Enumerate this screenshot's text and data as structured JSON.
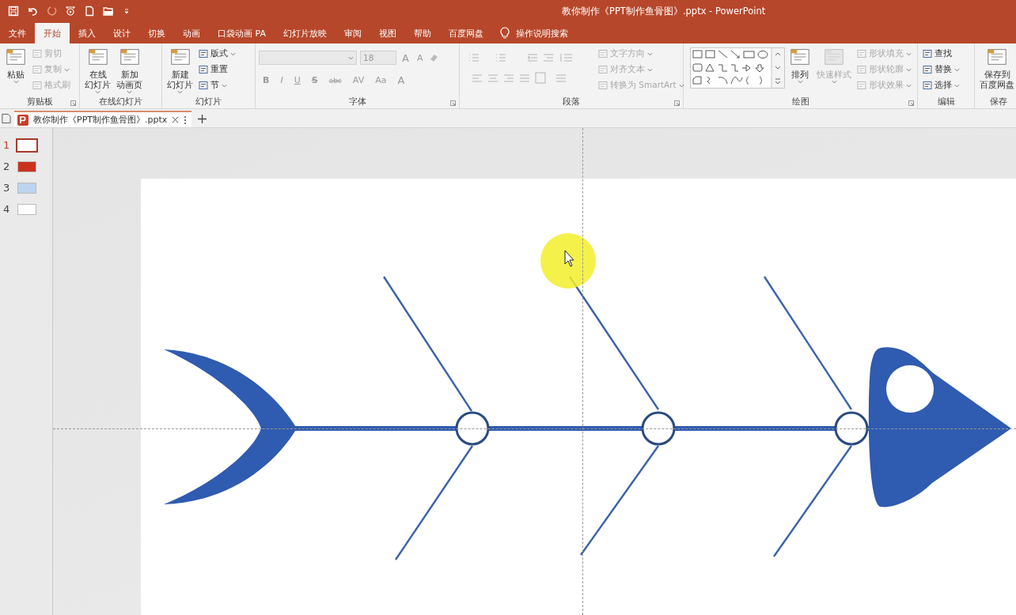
{
  "window": {
    "title": "教你制作《PPT制作鱼骨图》.pptx  -  PowerPoint"
  },
  "menu_tabs": [
    {
      "label": "文件",
      "selected": false
    },
    {
      "label": "开始",
      "selected": true
    },
    {
      "label": "插入",
      "selected": false
    },
    {
      "label": "设计",
      "selected": false
    },
    {
      "label": "切换",
      "selected": false
    },
    {
      "label": "动画",
      "selected": false
    },
    {
      "label": "口袋动画 PA",
      "selected": false
    },
    {
      "label": "幻灯片放映",
      "selected": false
    },
    {
      "label": "审阅",
      "selected": false
    },
    {
      "label": "视图",
      "selected": false
    },
    {
      "label": "帮助",
      "selected": false
    },
    {
      "label": "百度网盘",
      "selected": false
    }
  ],
  "tell_me": {
    "placeholder": "操作说明搜索"
  },
  "ribbon_groups": [
    {
      "label": "剪贴板",
      "launcher": true,
      "columns": [
        {
          "kind": "large",
          "lines": [
            "粘贴"
          ],
          "dropdown": true,
          "disabled": false
        },
        {
          "kind": "stack",
          "items": [
            {
              "label": "剪切",
              "dropdown": false,
              "disabled": true
            },
            {
              "label": "复制",
              "dropdown": true,
              "disabled": true
            },
            {
              "label": "格式刷",
              "dropdown": false,
              "disabled": true
            }
          ]
        }
      ]
    },
    {
      "label": "在线幻灯片",
      "launcher": false,
      "columns": [
        {
          "kind": "large",
          "lines": [
            "在线",
            "幻灯片"
          ],
          "dropdown": true,
          "disabled": false
        },
        {
          "kind": "large",
          "lines": [
            "新加",
            "动画页"
          ],
          "dropdown": true,
          "disabled": false
        }
      ]
    },
    {
      "label": "幻灯片",
      "launcher": false,
      "columns": [
        {
          "kind": "large",
          "lines": [
            "新建",
            "幻灯片"
          ],
          "dropdown": true,
          "disabled": false
        },
        {
          "kind": "stack",
          "items": [
            {
              "label": "版式",
              "dropdown": true,
              "disabled": false
            },
            {
              "label": "重置",
              "dropdown": false,
              "disabled": false
            },
            {
              "label": "节",
              "dropdown": true,
              "disabled": false
            }
          ]
        }
      ]
    },
    {
      "label": "字体",
      "launcher": true,
      "columns": [
        {
          "kind": "font",
          "disabled": true,
          "size": "18",
          "row1": [
            "A",
            "A"
          ],
          "row2": [
            "B",
            "I",
            "U",
            "S",
            "abc",
            "AV",
            "Aa",
            "A"
          ]
        }
      ]
    },
    {
      "label": "段落",
      "launcher": true,
      "columns": [
        {
          "kind": "paragraph",
          "disabled": true
        },
        {
          "kind": "stack",
          "items": [
            {
              "label": "文字方向",
              "dropdown": true,
              "disabled": true
            },
            {
              "label": "对齐文本",
              "dropdown": true,
              "disabled": true
            },
            {
              "label": "转换为 SmartArt",
              "dropdown": true,
              "disabled": true
            }
          ]
        }
      ]
    },
    {
      "label": "绘图",
      "launcher": true,
      "columns": [
        {
          "kind": "gallery"
        },
        {
          "kind": "large",
          "lines": [
            "排列"
          ],
          "dropdown": true,
          "disabled": false
        },
        {
          "kind": "large",
          "lines": [
            "快速样式"
          ],
          "dropdown": true,
          "disabled": true
        },
        {
          "kind": "stack",
          "items": [
            {
              "label": "形状填充",
              "dropdown": true,
              "disabled": true
            },
            {
              "label": "形状轮廓",
              "dropdown": true,
              "disabled": true
            },
            {
              "label": "形状效果",
              "dropdown": true,
              "disabled": true
            }
          ]
        }
      ]
    },
    {
      "label": "编辑",
      "launcher": false,
      "columns": [
        {
          "kind": "stack",
          "items": [
            {
              "label": "查找",
              "dropdown": false,
              "disabled": false
            },
            {
              "label": "替换",
              "dropdown": true,
              "disabled": false
            },
            {
              "label": "选择",
              "dropdown": true,
              "disabled": false
            }
          ]
        }
      ]
    },
    {
      "label": "保存",
      "launcher": false,
      "columns": [
        {
          "kind": "large",
          "lines": [
            "保存到",
            "百度网盘"
          ],
          "dropdown": false,
          "disabled": false
        }
      ]
    }
  ],
  "document_tab": {
    "title": "教你制作《PPT制作鱼骨图》.pptx"
  },
  "slides": [
    {
      "number": "1",
      "selected": true,
      "color": "#ffffff"
    },
    {
      "number": "2",
      "selected": false,
      "color": "#c8321e"
    },
    {
      "number": "3",
      "selected": false,
      "color": "#bcd4ee"
    },
    {
      "number": "4",
      "selected": false,
      "color": "#ffffff"
    }
  ]
}
